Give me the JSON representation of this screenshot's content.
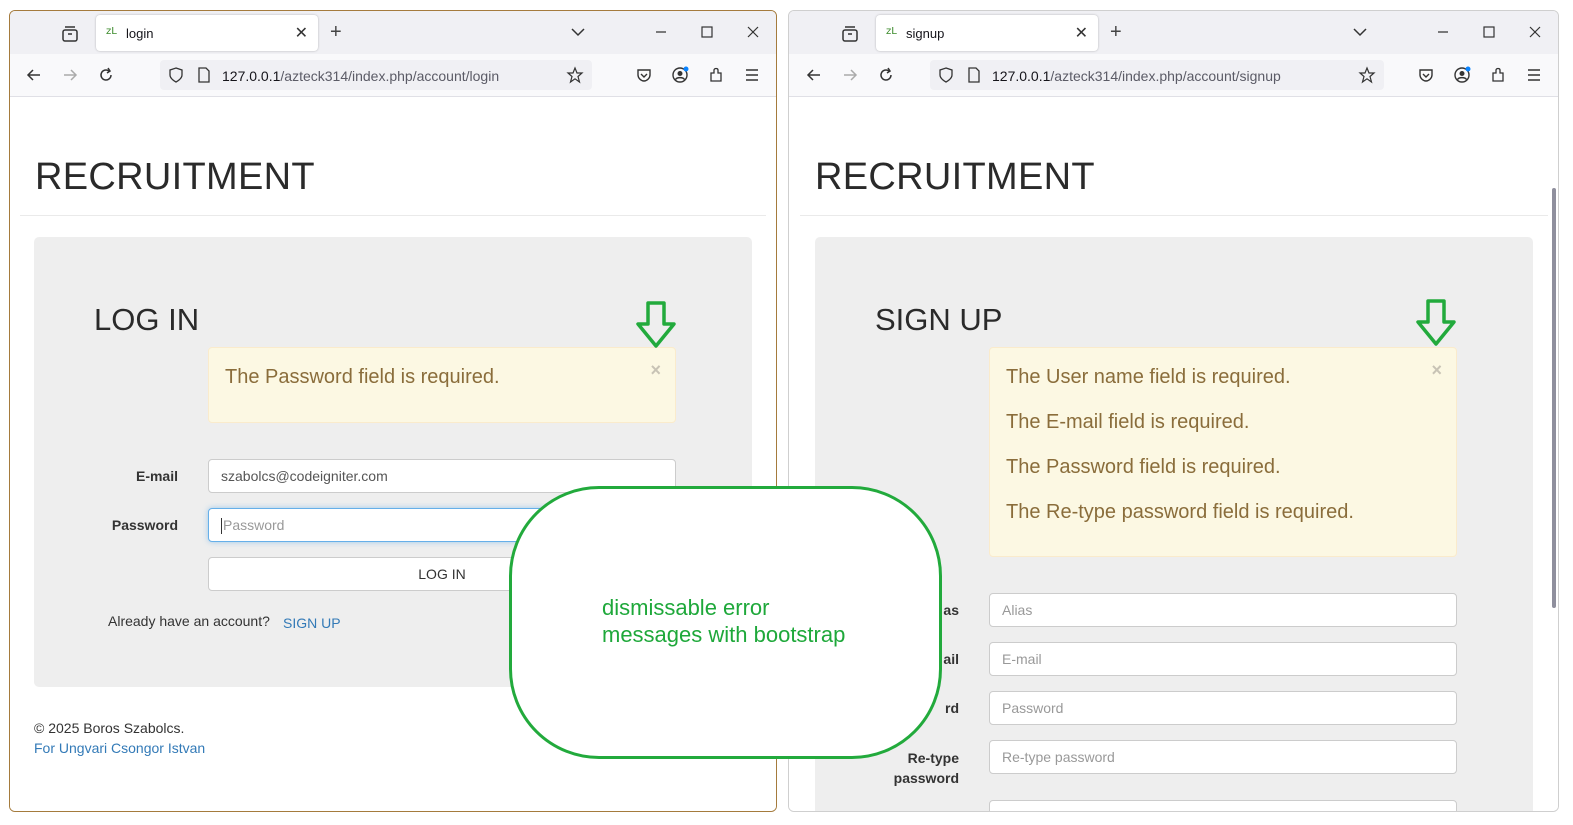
{
  "colors": {
    "accent_callout": "#22aa3c",
    "alert_bg": "#fcf8e3",
    "alert_text": "#8a6d3b",
    "link": "#337ab7",
    "panel_bg": "#eeeeee"
  },
  "left_window": {
    "tab_title": "login",
    "favicon_text": "zL",
    "url_host": "127.0.0.1",
    "url_path": "/azteck314/index.php/account/login",
    "site_title": "RECRUITMENT",
    "panel_title": "LOG IN",
    "alert_messages": [
      "The Password field is required."
    ],
    "alert_close": "×",
    "email_label": "E-mail",
    "email_value": "szabolcs@codeigniter.com",
    "password_label": "Password",
    "password_placeholder": "Password",
    "login_button": "LOG IN",
    "account_prompt": "Already have an account?",
    "signup_link": "SIGN UP",
    "footer_copyright": "© 2025 Boros Szabolcs.",
    "footer_link": "For Ungvari Csongor Istvan"
  },
  "right_window": {
    "tab_title": "signup",
    "favicon_text": "zL",
    "url_host": "127.0.0.1",
    "url_path": "/azteck314/index.php/account/signup",
    "site_title": "RECRUITMENT",
    "panel_title": "SIGN UP",
    "alert_messages": [
      "The User name field is required.",
      "The E-mail field is required.",
      "The Password field is required.",
      "The Re-type password field is required."
    ],
    "alert_close": "×",
    "fields": [
      {
        "label": "Alias",
        "visible_label": "as",
        "placeholder": "Alias"
      },
      {
        "label": "E-mail",
        "visible_label": "ail",
        "placeholder": "E-mail"
      },
      {
        "label": "Password",
        "visible_label": "rd",
        "placeholder": "Password"
      },
      {
        "label": "Re-type password",
        "visible_label": "Re-type\npassword",
        "placeholder": "Re-type password"
      }
    ]
  },
  "callout": {
    "text": "dismissable error\nmessages with bootstrap"
  },
  "icons": [
    "tab-manager-icon",
    "close-icon",
    "plus-icon",
    "chevron-down-icon",
    "minimize-icon",
    "maximize-icon",
    "back-icon",
    "forward-icon",
    "reload-icon",
    "shield-icon",
    "page-icon",
    "star-icon",
    "pocket-icon",
    "account-icon",
    "extensions-icon",
    "menu-icon",
    "arrow-down-icon"
  ]
}
